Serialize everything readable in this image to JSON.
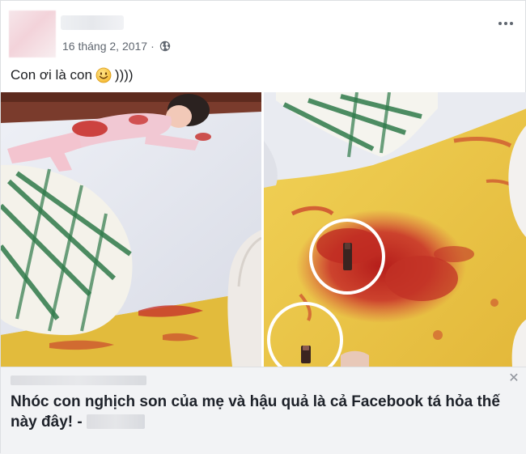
{
  "post": {
    "date": "16 tháng 2, 2017",
    "separator": "·",
    "privacy_icon": "globe-icon",
    "more_icon": "more-options-icon",
    "caption_start": "Con ơi là con",
    "caption_emoji": "smiley-emoji",
    "caption_end": "))))"
  },
  "link_preview": {
    "title": "Nhóc con nghịch son của mẹ và hậu quả là cả Facebook tá hỏa thế này đây! -",
    "close_icon": "close-icon",
    "close_symbol": "✕"
  },
  "colors": {
    "meta_text": "#606770",
    "link_bg": "#f2f3f5",
    "border": "#dddfe2",
    "floor": "#e8c54a",
    "stain": "#c0271f"
  }
}
